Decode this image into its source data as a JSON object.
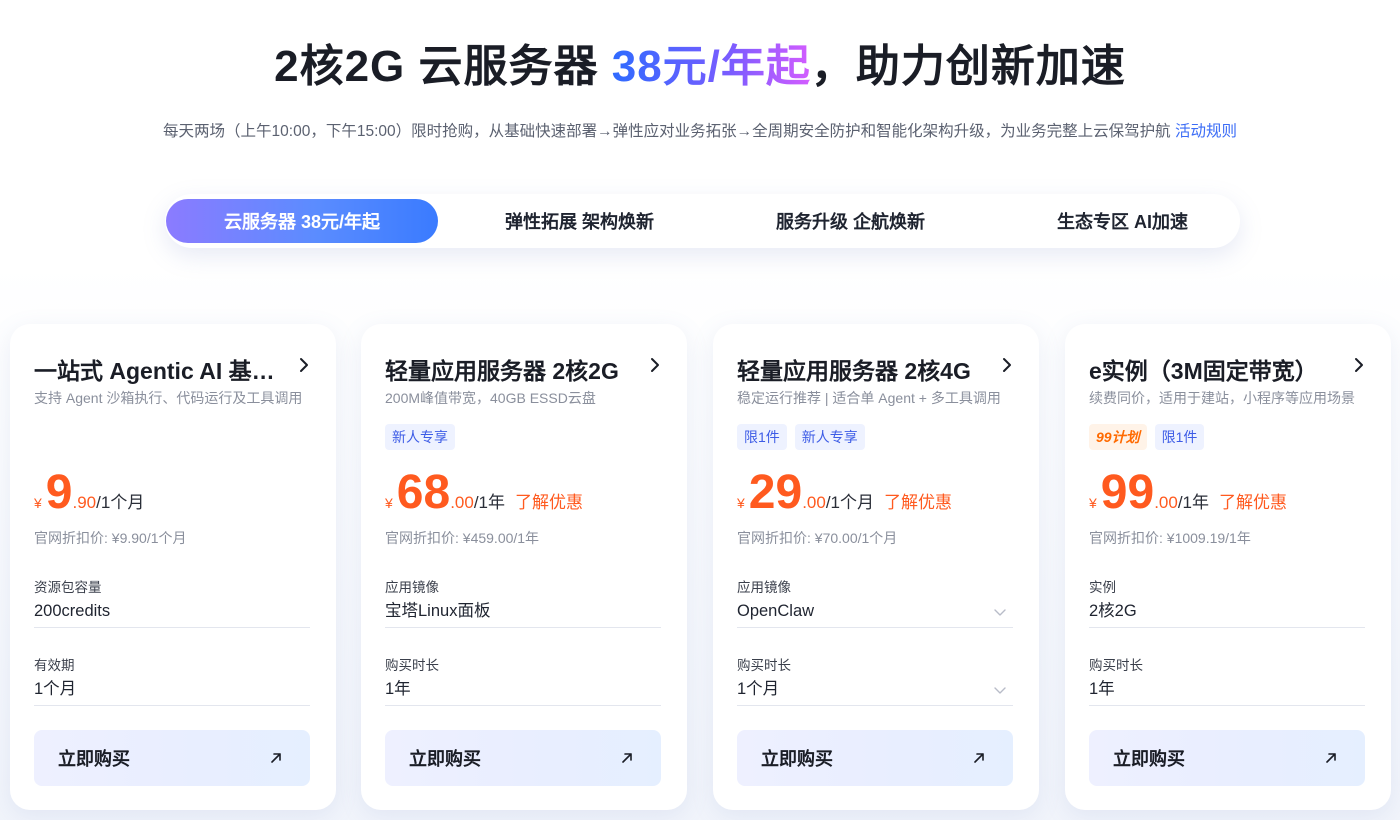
{
  "hero": {
    "title_pre": "2核2G 云服务器 ",
    "title_accent": "38元/年起",
    "title_post": "，助力创新加速",
    "subtitle": "每天两场（上午10:00，下午15:00）限时抢购，从基础快速部署→弹性应对业务拓张→全周期安全防护和智能化架构升级，为业务完整上云保驾护航 ",
    "rules_link": "活动规则"
  },
  "tabs": [
    {
      "label": "云服务器 38元/年起",
      "active": true
    },
    {
      "label": "弹性拓展 架构焕新",
      "active": false
    },
    {
      "label": "服务升级 企航焕新",
      "active": false
    },
    {
      "label": "生态专区 AI加速",
      "active": false
    }
  ],
  "cards": [
    {
      "title": "一站式 Agentic AI 基础设施",
      "desc": "支持 Agent 沙箱执行、代码运行及工具调用",
      "tags": [],
      "currency": "¥",
      "price_int": "9",
      "price_dec": ".90",
      "price_unit": "/1个月",
      "promo": "",
      "orig_price": "官网折扣价: ¥9.90/1个月",
      "field1_label": "资源包容量",
      "field1_value": "200credits",
      "field1_dropdown": false,
      "field2_label": "有效期",
      "field2_value": "1个月",
      "field2_dropdown": false,
      "buy_label": "立即购买"
    },
    {
      "title": "轻量应用服务器 2核2G",
      "desc": "200M峰值带宽，40GB ESSD云盘",
      "tags": [
        {
          "text": "新人专享",
          "type": "normal"
        }
      ],
      "currency": "¥",
      "price_int": "68",
      "price_dec": ".00",
      "price_unit": "/1年",
      "promo": "了解优惠",
      "orig_price": "官网折扣价: ¥459.00/1年",
      "field1_label": "应用镜像",
      "field1_value": "宝塔Linux面板",
      "field1_dropdown": false,
      "field2_label": "购买时长",
      "field2_value": "1年",
      "field2_dropdown": false,
      "buy_label": "立即购买"
    },
    {
      "title": "轻量应用服务器 2核4G",
      "desc": "稳定运行推荐 | 适合单 Agent + 多工具调用",
      "tags": [
        {
          "text": "限1件",
          "type": "normal"
        },
        {
          "text": "新人专享",
          "type": "normal"
        }
      ],
      "currency": "¥",
      "price_int": "29",
      "price_dec": ".00",
      "price_unit": "/1个月",
      "promo": "了解优惠",
      "orig_price": "官网折扣价: ¥70.00/1个月",
      "field1_label": "应用镜像",
      "field1_value": "OpenClaw",
      "field1_dropdown": true,
      "field2_label": "购买时长",
      "field2_value": "1个月",
      "field2_dropdown": true,
      "buy_label": "立即购买"
    },
    {
      "title": "e实例（3M固定带宽）",
      "desc": "续费同价，适用于建站，小程序等应用场景",
      "tags": [
        {
          "text": "99计划",
          "type": "plan"
        },
        {
          "text": "限1件",
          "type": "normal"
        }
      ],
      "currency": "¥",
      "price_int": "99",
      "price_dec": ".00",
      "price_unit": "/1年",
      "promo": "了解优惠",
      "orig_price": "官网折扣价: ¥1009.19/1年",
      "field1_label": "实例",
      "field1_value": "2核2G",
      "field1_dropdown": false,
      "field2_label": "购买时长",
      "field2_value": "1年",
      "field2_dropdown": false,
      "buy_label": "立即购买"
    }
  ],
  "icons": {
    "chevron": "chevron-right-icon",
    "dropdown": "chevron-down-icon",
    "arrow": "arrow-up-right-icon"
  },
  "colors": {
    "accent_blue": "#3b6cf6",
    "price_orange": "#ff5a1f",
    "tab_gradient_start": "#8b7bff",
    "tab_gradient_end": "#3a7bff"
  }
}
